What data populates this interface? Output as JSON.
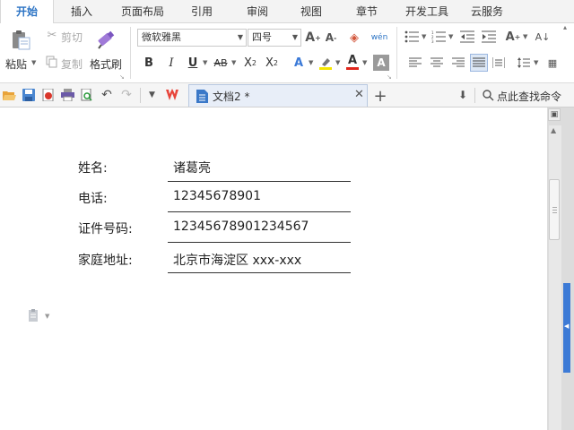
{
  "menu": {
    "tabs": [
      "开始",
      "插入",
      "页面布局",
      "引用",
      "审阅",
      "视图",
      "章节",
      "开发工具",
      "云服务"
    ]
  },
  "ribbon": {
    "paste_label": "粘贴",
    "cut_label": "剪切",
    "copy_label": "复制",
    "format_painter_label": "格式刷",
    "font_name": "微软雅黑",
    "font_size": "四号"
  },
  "quickbar": {
    "doc_tab_title": "文档2 *",
    "search_label": "点此查找命令"
  },
  "document": {
    "fields": [
      {
        "label": "姓名:",
        "value": "诸葛亮"
      },
      {
        "label": "电话:",
        "value": "12345678901"
      },
      {
        "label": "证件号码:",
        "value": "12345678901234567"
      },
      {
        "label": "家庭地址:",
        "value": "北京市海淀区 xxx-xxx"
      }
    ]
  },
  "colors": {
    "accent": "#2b73c4",
    "wps_red": "#e8443a",
    "scroll_blue": "#3c7ad6"
  }
}
